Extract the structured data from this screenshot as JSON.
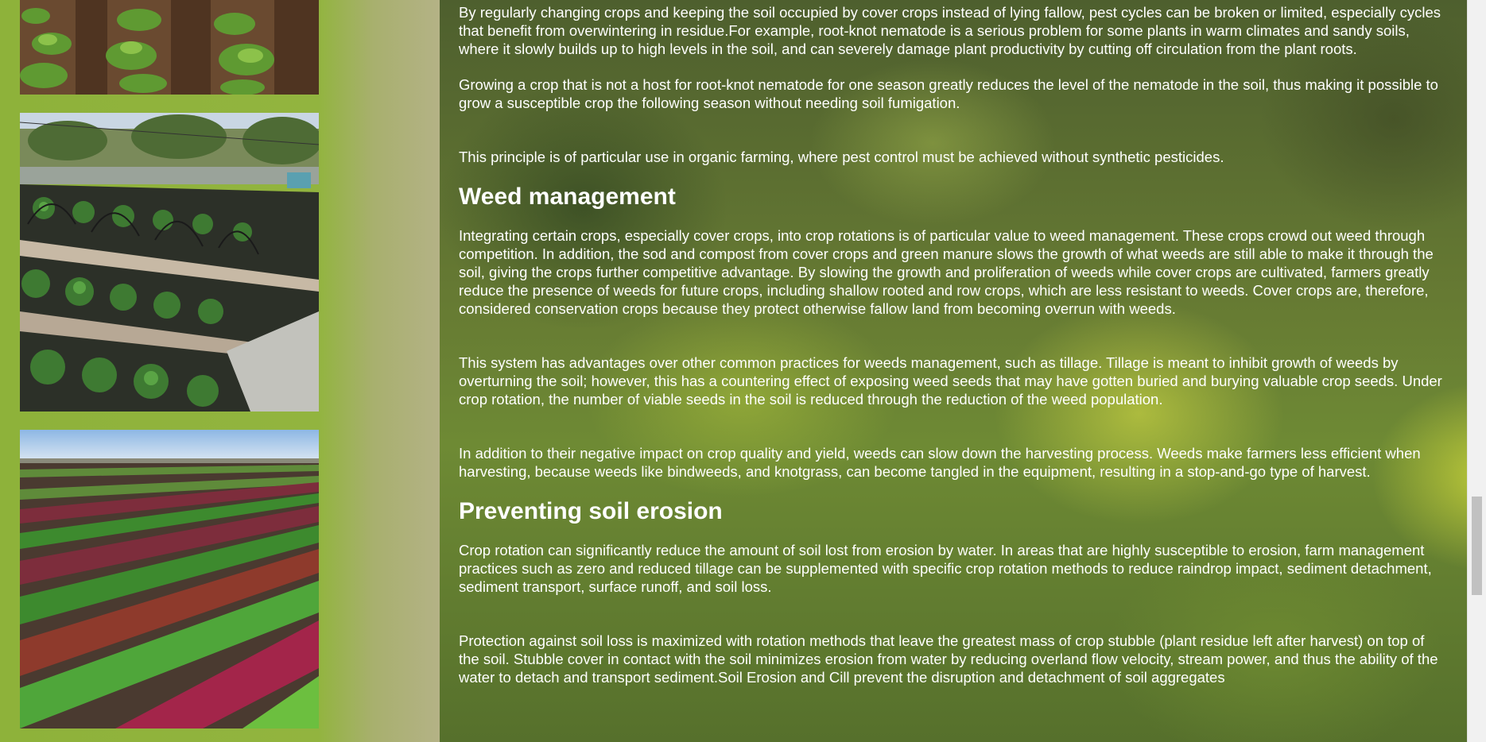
{
  "sidebar": {
    "photos": [
      {
        "name": "seedling-rows-photo"
      },
      {
        "name": "mulched-garden-beds-photo"
      },
      {
        "name": "lettuce-field-rows-photo"
      }
    ]
  },
  "article": {
    "paragraphs_pest": [
      "By regularly changing crops and keeping the soil occupied by cover crops instead of lying fallow, pest cycles can be broken or limited, especially cycles that benefit from overwintering in residue.For example, root-knot nematode is a serious problem for some plants in warm climates and sandy soils, where it slowly builds up to high levels in the soil, and can severely damage plant productivity by cutting off circulation from the plant roots.",
      "Growing a crop that is not a host for root-knot nematode for one season greatly reduces the level of the nematode in the soil, thus making it possible to grow a susceptible crop the following season without needing soil fumigation.",
      "This principle is of particular use in organic farming, where pest control must be achieved without synthetic pesticides."
    ],
    "weed_heading": "Weed management",
    "paragraphs_weed": [
      "Integrating certain crops, especially cover crops, into crop rotations is of particular value to weed management. These crops crowd out weed through competition. In addition, the sod and compost from cover crops and green manure slows the growth of what weeds are still able to make it through the soil, giving the crops further competitive advantage. By slowing the growth and proliferation of weeds while cover crops are cultivated, farmers greatly reduce the presence of weeds for future crops, including shallow rooted and row crops, which are less resistant to weeds. Cover crops are, therefore, considered conservation crops because they protect otherwise fallow land from becoming overrun with weeds.",
      "This system has advantages over other common practices for weeds management, such as tillage. Tillage is meant to inhibit growth of weeds by overturning the soil; however, this has a countering effect of exposing weed seeds that may have gotten buried and burying valuable crop seeds. Under crop rotation, the number of viable seeds in the soil is reduced through the reduction of the weed population.",
      "In addition to their negative impact on crop quality and yield, weeds can slow down the harvesting process. Weeds make farmers less efficient when harvesting, because weeds like bindweeds, and knotgrass, can become tangled in the equipment, resulting in a stop-and-go type of harvest."
    ],
    "erosion_heading": "Preventing soil erosion",
    "paragraphs_erosion": [
      "Crop rotation can significantly reduce the amount of soil lost from erosion by water. In areas that are highly susceptible to erosion, farm management practices such as zero and reduced tillage can be supplemented with specific crop rotation methods to reduce raindrop impact, sediment detachment, sediment transport, surface runoff, and soil loss.",
      "Protection against soil loss is maximized with rotation methods that leave the greatest mass of crop stubble (plant residue left after harvest) on top of the soil. Stubble cover in contact with the soil minimizes erosion from water by reducing overland flow velocity, stream power, and thus the ability of the water to detach and transport sediment.Soil Erosion and Cill prevent the disruption and detachment of soil aggregates"
    ]
  },
  "colors": {
    "text": "#ffffff",
    "sidebar_green": "#8fb13d",
    "scrollbar_track": "#f1f1f1",
    "scrollbar_thumb": "#c1c1c1"
  }
}
